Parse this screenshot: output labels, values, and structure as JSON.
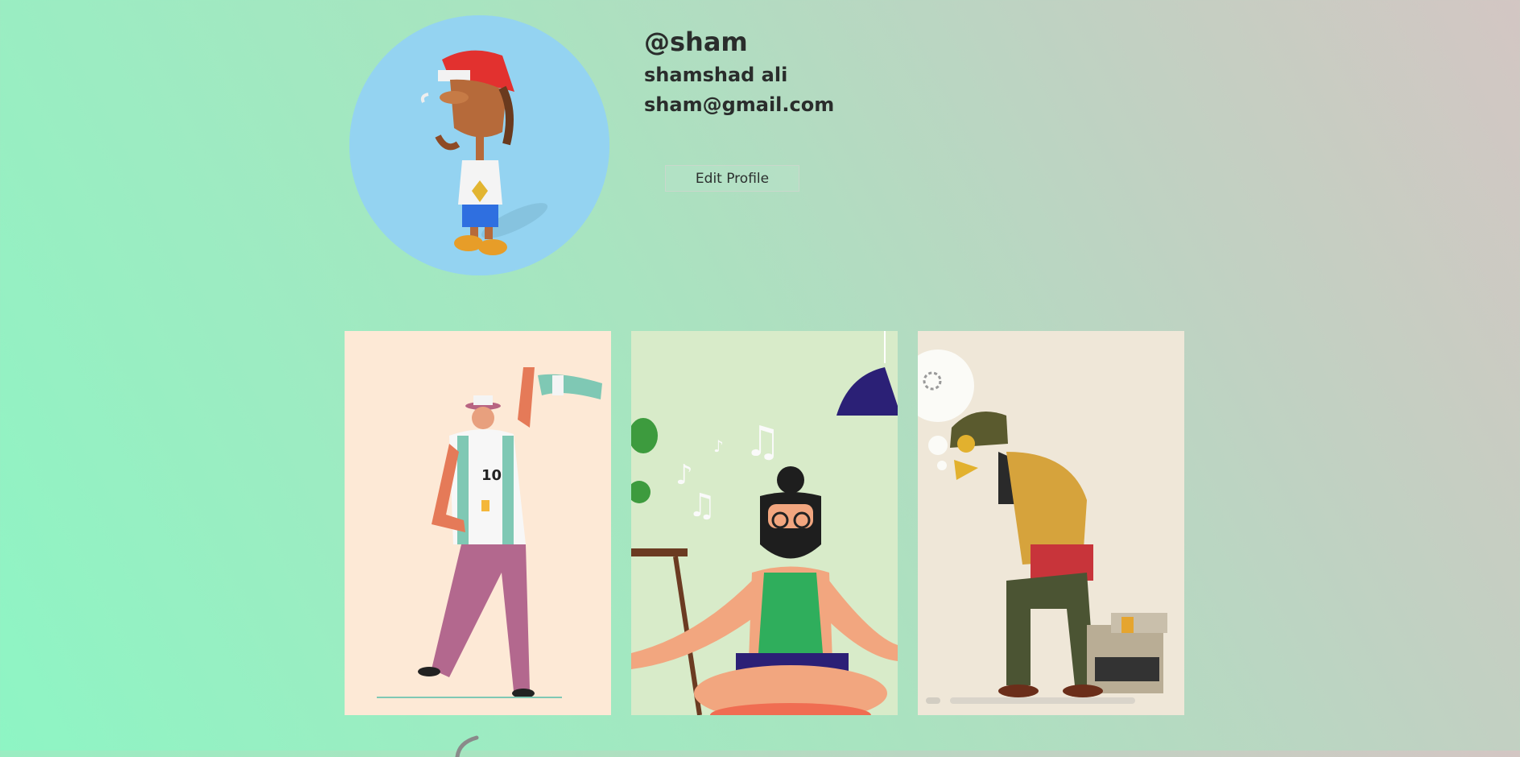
{
  "profile": {
    "username": "@sham",
    "full_name": "shamshad ali",
    "email": "sham@gmail.com",
    "edit_button_label": "Edit Profile",
    "avatar_icon": "cartoon-avatar-image"
  },
  "posts": [
    {
      "icon": "football-fan-illustration"
    },
    {
      "icon": "meditating-man-illustration"
    },
    {
      "icon": "sad-worker-illustration"
    }
  ],
  "colors": {
    "background_start": "#8ef5c4",
    "background_end": "#d3c6c3",
    "avatar_bg": "#94d3f1",
    "text": "#2a2d2c"
  }
}
